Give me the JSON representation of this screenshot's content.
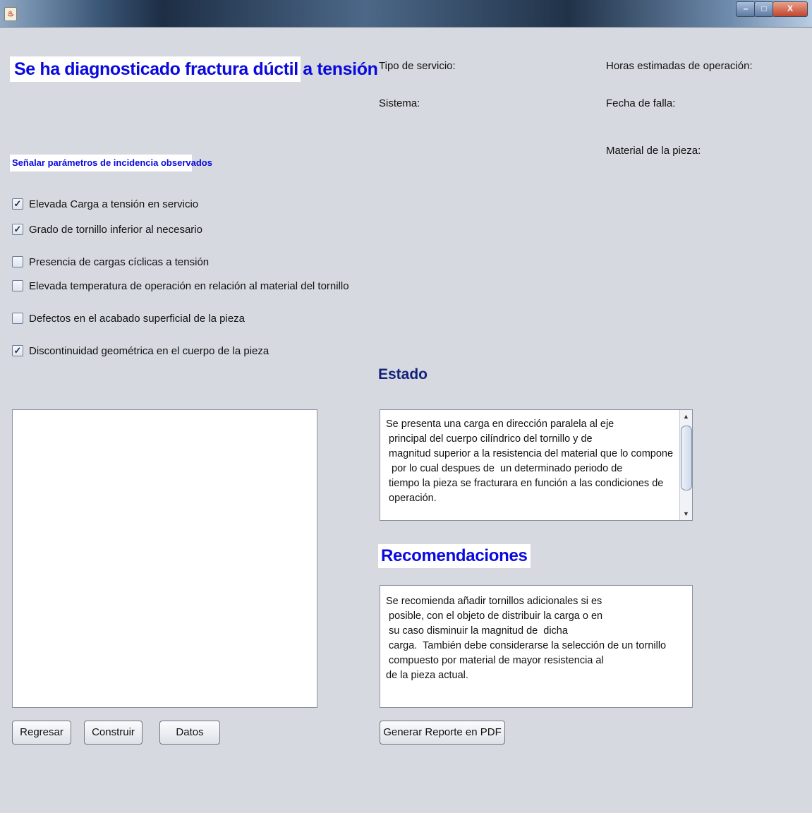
{
  "window": {
    "icon": "java-icon",
    "controls": {
      "minimize": "–",
      "maximize": "□",
      "close": "X"
    }
  },
  "diagnosis_title": "Se ha diagnosticado fractura dúctil a tensión",
  "params_label": "Señalar parámetros de incidencia observados",
  "parameters": [
    {
      "label": "Elevada Carga a tensión en servicio",
      "checked": true
    },
    {
      "label": "Grado de tornillo inferior al necesario",
      "checked": true
    },
    {
      "label": "Presencia de cargas cíclicas a tensión",
      "checked": false
    },
    {
      "label": "Elevada temperatura de operación en relación al material del tornillo",
      "checked": false
    },
    {
      "label": "Defectos en el acabado superficial de la pieza",
      "checked": false
    },
    {
      "label": "Discontinuidad geométrica en el cuerpo de la pieza",
      "checked": true
    }
  ],
  "info": {
    "tipo_servicio": "Tipo de servicio:",
    "sistema": "Sistema:",
    "horas": "Horas estimadas de operación:",
    "fecha": "Fecha de falla:",
    "material": "Material de la pieza:"
  },
  "estado": {
    "heading": "Estado",
    "text": "Se presenta una carga en dirección paralela al eje\n principal del cuerpo cilíndrico del tornillo y de\n magnitud superior a la resistencia del material que lo compone\n  por lo cual despues de  un determinado periodo de\n tiempo la pieza se fracturara en función a las condiciones de\n operación."
  },
  "recomendaciones": {
    "heading": "Recomendaciones",
    "text": "Se recomienda añadir tornillos adicionales si es\n posible, con el objeto de distribuir la carga o en\n su caso disminuir la magnitud de  dicha\n carga.  También debe considerarse la selección de un tornillo\n compuesto por material de mayor resistencia al\nde la pieza actual."
  },
  "buttons": {
    "regresar": "Regresar",
    "construir": "Construir",
    "datos": "Datos",
    "pdf": "Generar Reporte en PDF"
  }
}
